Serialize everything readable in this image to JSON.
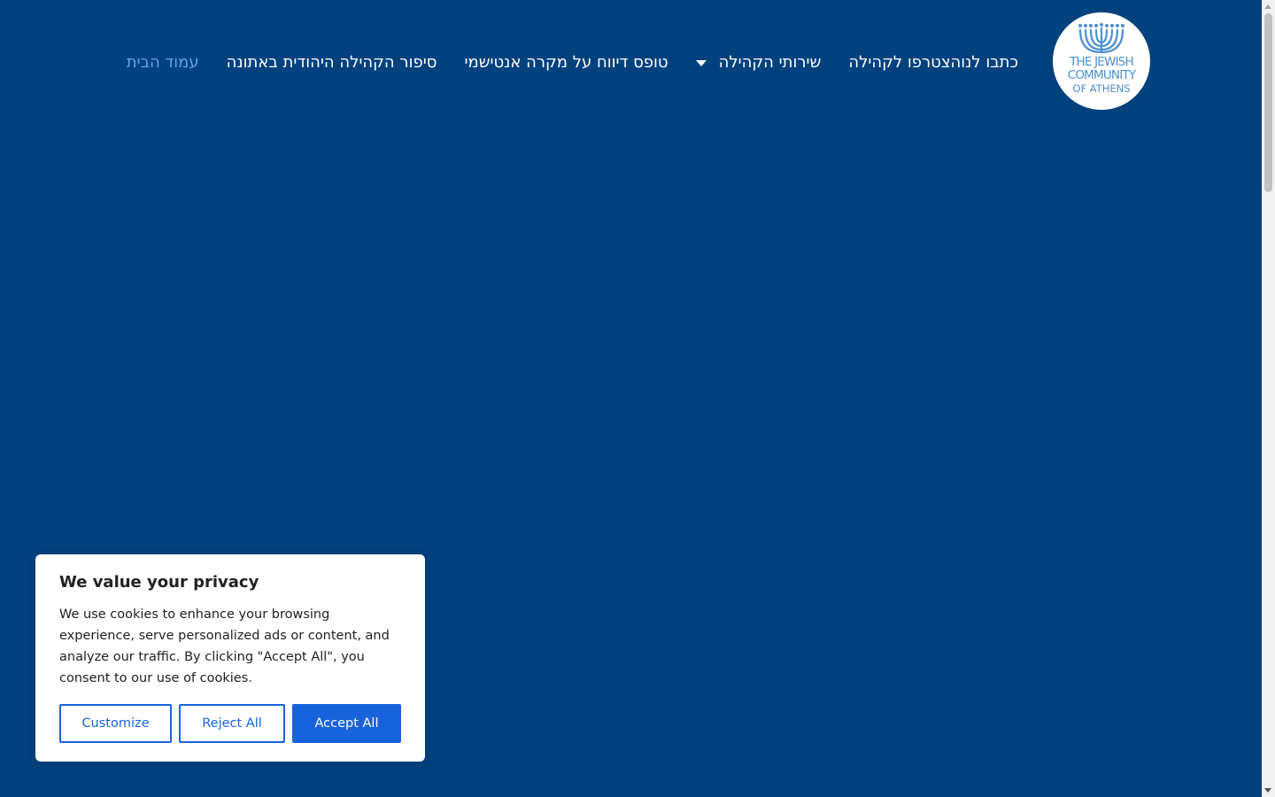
{
  "logo": {
    "line1": "THE JEWISH",
    "line2": "COMMUNITY",
    "line3": "OF ATHENS",
    "color": "#4d8fd0"
  },
  "nav": {
    "items": [
      {
        "label": "עמוד הבית",
        "active": true
      },
      {
        "label": "סיפור הקהילה היהודית באתונה"
      },
      {
        "label": "טופס דיווח על מקרה אנטישמי"
      },
      {
        "label": "שירותי הקהילה",
        "has_dropdown": true
      },
      {
        "label": "הצטרפו לקהילה"
      },
      {
        "label": "כתבו לנו"
      }
    ]
  },
  "cookie": {
    "title": "We value your privacy",
    "body": "We use cookies to enhance your browsing experience, serve personalized ads or content, and analyze our traffic. By clicking \"Accept All\", you consent to our use of cookies.",
    "customize": "Customize",
    "reject": "Reject All",
    "accept": "Accept All"
  },
  "colors": {
    "background": "#00417e",
    "active_nav": "#61a5ee",
    "button_blue": "#1863dc"
  }
}
